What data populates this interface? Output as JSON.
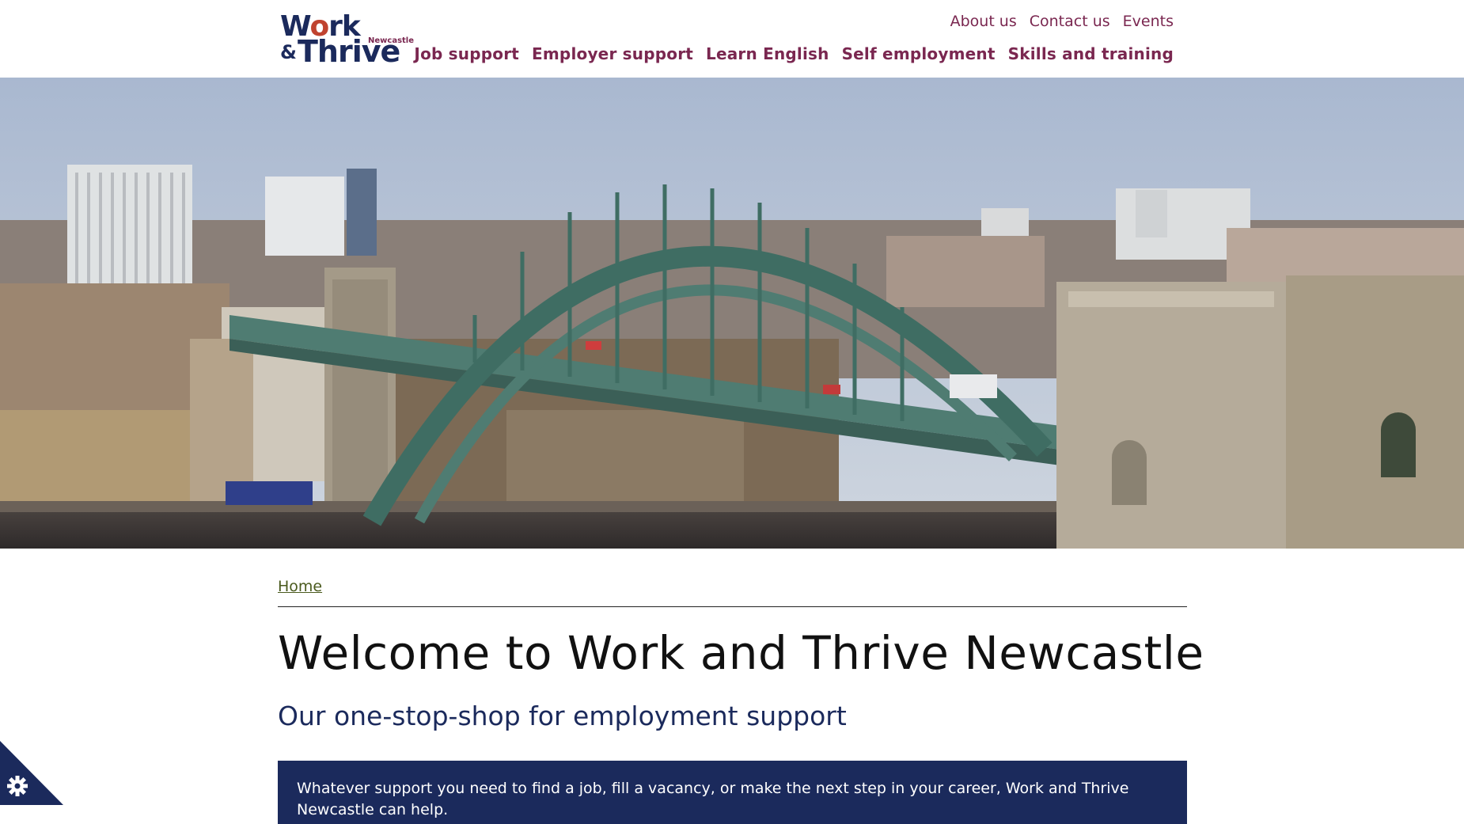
{
  "brand": {
    "logo_line1_a": "W",
    "logo_line1_o": "o",
    "logo_line1_b": "rk",
    "logo_amp": "&",
    "logo_line2": "Thrive",
    "logo_city": "Newcastle"
  },
  "top_links": [
    {
      "label": "About us"
    },
    {
      "label": "Contact us"
    },
    {
      "label": "Events"
    }
  ],
  "main_nav": [
    {
      "label": "Job support"
    },
    {
      "label": "Employer support"
    },
    {
      "label": "Learn English"
    },
    {
      "label": "Self employment"
    },
    {
      "label": "Skills and training"
    }
  ],
  "breadcrumb": {
    "home": "Home"
  },
  "page": {
    "title": "Welcome to Work and Thrive Newcastle",
    "subtitle": "Our one-stop-shop for employment support",
    "intro": "Whatever support you need to find a job, fill a vacancy, or make the next step in your career, Work and Thrive Newcastle can help."
  },
  "colors": {
    "brand_navy": "#1b2a5c",
    "nav_plum": "#7a2750",
    "breadcrumb_olive": "#4a5a1e",
    "logo_accent": "#c0432f"
  },
  "icons": {
    "cookie_settings": "gear-icon"
  }
}
